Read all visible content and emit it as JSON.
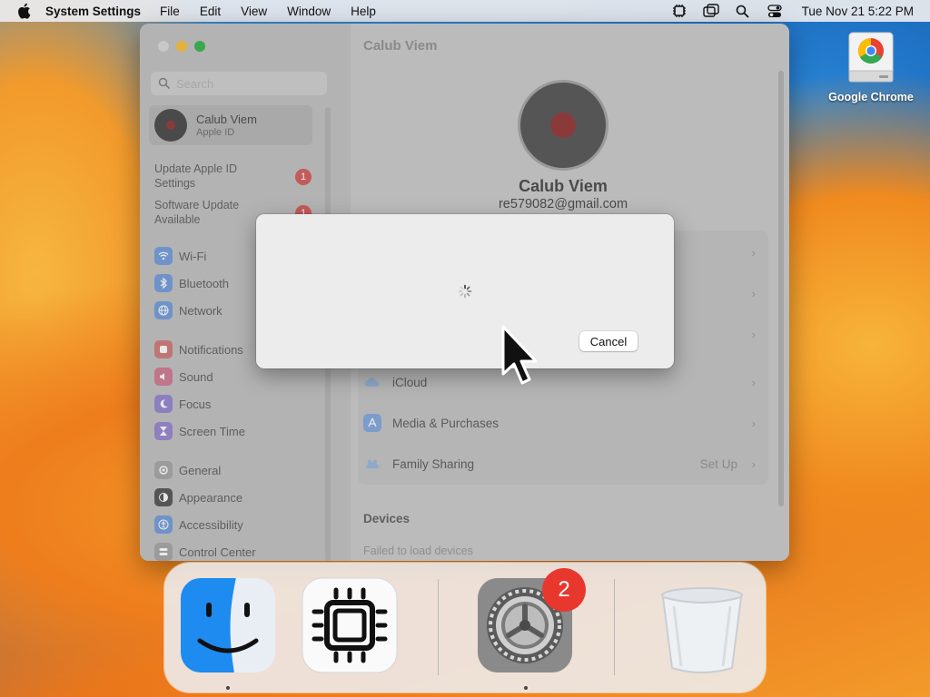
{
  "menubar": {
    "app_name": "System Settings",
    "menus": [
      "File",
      "Edit",
      "View",
      "Window",
      "Help"
    ],
    "clock": "Tue Nov 21  5:22 PM"
  },
  "desktop": {
    "icons": [
      {
        "label": "Google Chrome",
        "icon": "chrome-drive-icon"
      }
    ]
  },
  "window": {
    "title": "Calub Viem",
    "search_placeholder": "Search",
    "account": {
      "name": "Calub Viem",
      "subtitle": "Apple ID"
    },
    "alerts": [
      {
        "line1": "Update Apple ID",
        "line2": "Settings",
        "badge": "1"
      },
      {
        "line1": "Software Update",
        "line2": "Available",
        "badge": "1"
      }
    ],
    "sidebar_items": [
      {
        "label": "Wi-Fi",
        "icon": "wifi-icon",
        "color": "#3b7bd4"
      },
      {
        "label": "Bluetooth",
        "icon": "bluetooth-icon",
        "color": "#3b7bd4"
      },
      {
        "label": "Network",
        "icon": "globe-icon",
        "color": "#3b7bd4"
      },
      {
        "label": "Notifications",
        "icon": "bell-icon",
        "color": "#d24a4a"
      },
      {
        "label": "Sound",
        "icon": "speaker-icon",
        "color": "#d24a6a"
      },
      {
        "label": "Focus",
        "icon": "moon-icon",
        "color": "#6a4fc8"
      },
      {
        "label": "Screen Time",
        "icon": "hourglass-icon",
        "color": "#7a4fc8"
      },
      {
        "label": "General",
        "icon": "gear-icon",
        "color": "#8a8a8a"
      },
      {
        "label": "Appearance",
        "icon": "appearance-icon",
        "color": "#333333"
      },
      {
        "label": "Accessibility",
        "icon": "accessibility-icon",
        "color": "#3b7bd4"
      },
      {
        "label": "Control Center",
        "icon": "control-center-icon",
        "color": "#8a8a8a"
      }
    ],
    "profile": {
      "name": "Calub Viem",
      "email": "re579082@gmail.com"
    },
    "rows": [
      {
        "label": "",
        "value": ""
      },
      {
        "label": "",
        "value": ""
      },
      {
        "label": "",
        "value": ""
      },
      {
        "label": "iCloud",
        "icon": "cloud-icon",
        "value": ""
      },
      {
        "label": "Media & Purchases",
        "icon": "app-store-icon",
        "value": ""
      },
      {
        "label": "Family Sharing",
        "icon": "family-icon",
        "value": "Set Up"
      }
    ],
    "devices_header": "Devices",
    "devices_message": "Failed to load devices"
  },
  "dialog": {
    "cancel_label": "Cancel",
    "state": "loading"
  },
  "dock": {
    "apps": [
      {
        "name": "Finder",
        "icon": "finder-icon",
        "running": true
      },
      {
        "name": "Chip",
        "icon": "chip-icon",
        "running": false
      },
      {
        "name": "System Settings",
        "icon": "system-settings-icon",
        "running": true,
        "badge": "2"
      },
      {
        "name": "Trash",
        "icon": "trash-icon",
        "running": false
      }
    ]
  }
}
